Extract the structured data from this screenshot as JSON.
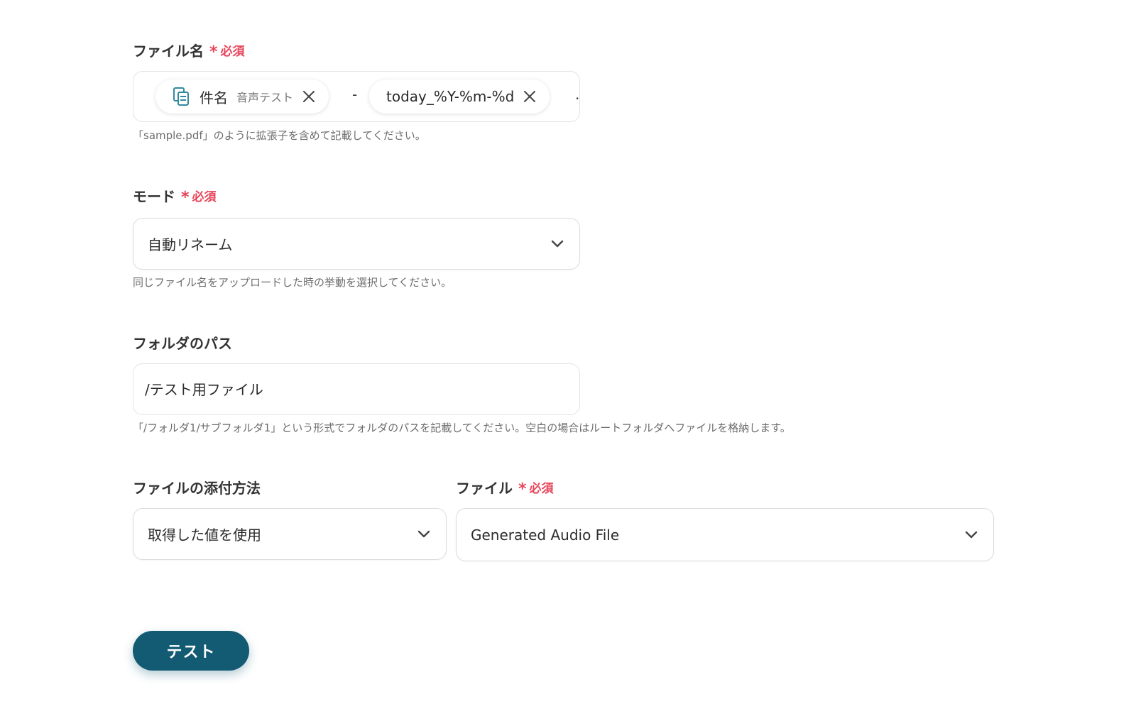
{
  "filename": {
    "label": "ファイル名",
    "required_label": "必須",
    "chip1": {
      "label": "件名",
      "sub": "音声テスト"
    },
    "separator": "-",
    "chip2": {
      "label": "today_%Y-%m-%d"
    },
    "trailing": ".",
    "hint": "「sample.pdf」のように拡張子を含めて記載してください。"
  },
  "mode": {
    "label": "モード",
    "required_label": "必須",
    "value": "自動リネーム",
    "hint": "同じファイル名をアップロードした時の挙動を選択してください。"
  },
  "folder": {
    "label": "フォルダのパス",
    "value": "/テスト用ファイル",
    "hint": "「/フォルダ1/サブフォルダ1」という形式でフォルダのパスを記載してください。空白の場合はルートフォルダへファイルを格納します。"
  },
  "attach": {
    "label": "ファイルの添付方法",
    "value": "取得した値を使用"
  },
  "file": {
    "label": "ファイル",
    "required_label": "必須",
    "value": "Generated Audio File"
  },
  "test_button": {
    "label": "テスト"
  },
  "colors": {
    "required": "#e8455a",
    "button": "#125b73",
    "chip_icon": "#2f8a9e"
  },
  "icons": {
    "chip1": "document-stack-icon",
    "close": "close-icon",
    "dropdown": "chevron-down-icon"
  }
}
